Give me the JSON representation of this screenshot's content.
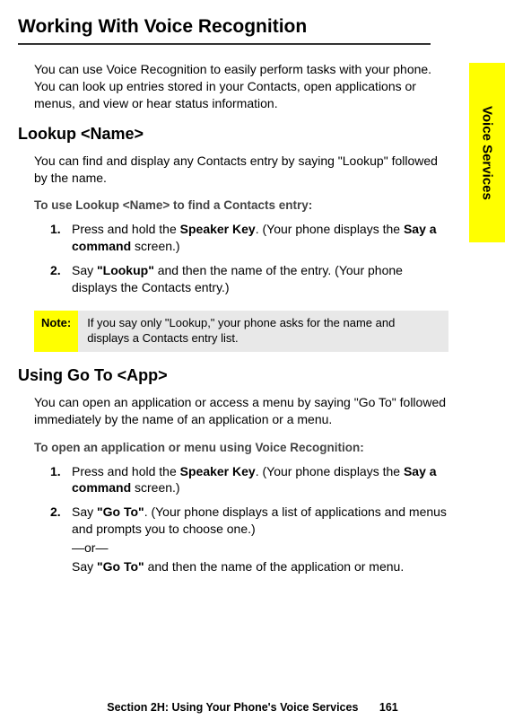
{
  "main_heading": "Working With Voice Recognition",
  "side_tab": "Voice Services",
  "intro": "You can use Voice Recognition to easily perform tasks with your phone. You can look up entries stored in your Contacts, open applications or menus, and view or hear status information.",
  "section1": {
    "heading": "Lookup <Name>",
    "para": "You can find and display any Contacts entry by saying \"Lookup\" followed by the name.",
    "instruction_heading": "To use Lookup <Name> to find a Contacts entry:",
    "steps": [
      {
        "num": "1.",
        "pre": "Press and hold the ",
        "b1": "Speaker Key",
        "mid1": ". (Your phone displays the ",
        "b2": "Say a command",
        "post": " screen.)"
      },
      {
        "num": "2.",
        "pre": "Say ",
        "b1": "\"Lookup\"",
        "post": " and then the name of the entry. (Your phone displays the Contacts entry.)"
      }
    ]
  },
  "note": {
    "label": "Note:",
    "text": "If you say only \"Lookup,\" your phone asks for the name and displays a Contacts entry list."
  },
  "section2": {
    "heading": "Using Go To <App>",
    "para": "You can open an application or access a menu by saying \"Go To\" followed immediately by the name of an application or a menu.",
    "instruction_heading": "To open an application or menu using Voice Recognition:",
    "steps": [
      {
        "num": "1.",
        "pre": "Press and hold the ",
        "b1": "Speaker Key",
        "mid1": ". (Your phone displays the ",
        "b2": "Say a command",
        "post": " screen.)"
      },
      {
        "num": "2.",
        "pre": "Say ",
        "b1": "\"Go To\"",
        "mid1": ". (Your phone displays a list of applications and menus and prompts you to choose one.)",
        "or": "—or—",
        "pre2": "Say ",
        "b2": "\"Go To\"",
        "post2": " and then the name of the application or menu."
      }
    ]
  },
  "footer": {
    "text": "Section 2H: Using Your Phone's Voice Services",
    "page": "161"
  }
}
